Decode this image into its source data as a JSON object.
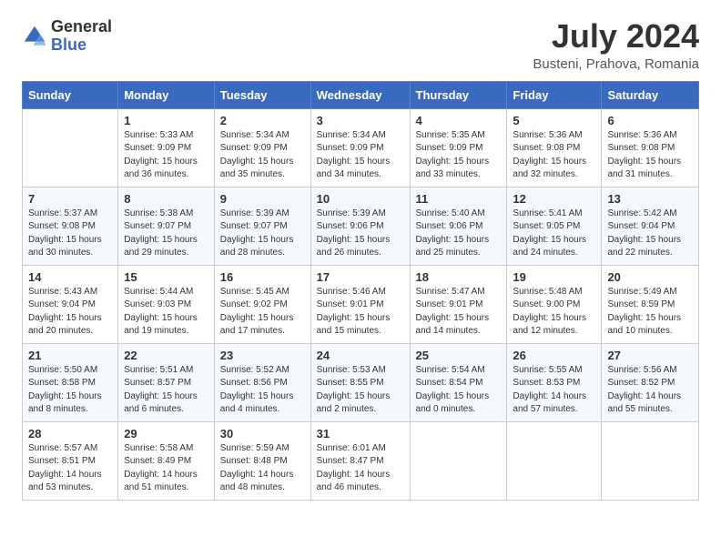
{
  "header": {
    "logo_general": "General",
    "logo_blue": "Blue",
    "month_year": "July 2024",
    "location": "Busteni, Prahova, Romania"
  },
  "weekdays": [
    "Sunday",
    "Monday",
    "Tuesday",
    "Wednesday",
    "Thursday",
    "Friday",
    "Saturday"
  ],
  "weeks": [
    [
      {
        "day": "",
        "info": ""
      },
      {
        "day": "1",
        "info": "Sunrise: 5:33 AM\nSunset: 9:09 PM\nDaylight: 15 hours\nand 36 minutes."
      },
      {
        "day": "2",
        "info": "Sunrise: 5:34 AM\nSunset: 9:09 PM\nDaylight: 15 hours\nand 35 minutes."
      },
      {
        "day": "3",
        "info": "Sunrise: 5:34 AM\nSunset: 9:09 PM\nDaylight: 15 hours\nand 34 minutes."
      },
      {
        "day": "4",
        "info": "Sunrise: 5:35 AM\nSunset: 9:09 PM\nDaylight: 15 hours\nand 33 minutes."
      },
      {
        "day": "5",
        "info": "Sunrise: 5:36 AM\nSunset: 9:08 PM\nDaylight: 15 hours\nand 32 minutes."
      },
      {
        "day": "6",
        "info": "Sunrise: 5:36 AM\nSunset: 9:08 PM\nDaylight: 15 hours\nand 31 minutes."
      }
    ],
    [
      {
        "day": "7",
        "info": "Sunrise: 5:37 AM\nSunset: 9:08 PM\nDaylight: 15 hours\nand 30 minutes."
      },
      {
        "day": "8",
        "info": "Sunrise: 5:38 AM\nSunset: 9:07 PM\nDaylight: 15 hours\nand 29 minutes."
      },
      {
        "day": "9",
        "info": "Sunrise: 5:39 AM\nSunset: 9:07 PM\nDaylight: 15 hours\nand 28 minutes."
      },
      {
        "day": "10",
        "info": "Sunrise: 5:39 AM\nSunset: 9:06 PM\nDaylight: 15 hours\nand 26 minutes."
      },
      {
        "day": "11",
        "info": "Sunrise: 5:40 AM\nSunset: 9:06 PM\nDaylight: 15 hours\nand 25 minutes."
      },
      {
        "day": "12",
        "info": "Sunrise: 5:41 AM\nSunset: 9:05 PM\nDaylight: 15 hours\nand 24 minutes."
      },
      {
        "day": "13",
        "info": "Sunrise: 5:42 AM\nSunset: 9:04 PM\nDaylight: 15 hours\nand 22 minutes."
      }
    ],
    [
      {
        "day": "14",
        "info": "Sunrise: 5:43 AM\nSunset: 9:04 PM\nDaylight: 15 hours\nand 20 minutes."
      },
      {
        "day": "15",
        "info": "Sunrise: 5:44 AM\nSunset: 9:03 PM\nDaylight: 15 hours\nand 19 minutes."
      },
      {
        "day": "16",
        "info": "Sunrise: 5:45 AM\nSunset: 9:02 PM\nDaylight: 15 hours\nand 17 minutes."
      },
      {
        "day": "17",
        "info": "Sunrise: 5:46 AM\nSunset: 9:01 PM\nDaylight: 15 hours\nand 15 minutes."
      },
      {
        "day": "18",
        "info": "Sunrise: 5:47 AM\nSunset: 9:01 PM\nDaylight: 15 hours\nand 14 minutes."
      },
      {
        "day": "19",
        "info": "Sunrise: 5:48 AM\nSunset: 9:00 PM\nDaylight: 15 hours\nand 12 minutes."
      },
      {
        "day": "20",
        "info": "Sunrise: 5:49 AM\nSunset: 8:59 PM\nDaylight: 15 hours\nand 10 minutes."
      }
    ],
    [
      {
        "day": "21",
        "info": "Sunrise: 5:50 AM\nSunset: 8:58 PM\nDaylight: 15 hours\nand 8 minutes."
      },
      {
        "day": "22",
        "info": "Sunrise: 5:51 AM\nSunset: 8:57 PM\nDaylight: 15 hours\nand 6 minutes."
      },
      {
        "day": "23",
        "info": "Sunrise: 5:52 AM\nSunset: 8:56 PM\nDaylight: 15 hours\nand 4 minutes."
      },
      {
        "day": "24",
        "info": "Sunrise: 5:53 AM\nSunset: 8:55 PM\nDaylight: 15 hours\nand 2 minutes."
      },
      {
        "day": "25",
        "info": "Sunrise: 5:54 AM\nSunset: 8:54 PM\nDaylight: 15 hours\nand 0 minutes."
      },
      {
        "day": "26",
        "info": "Sunrise: 5:55 AM\nSunset: 8:53 PM\nDaylight: 14 hours\nand 57 minutes."
      },
      {
        "day": "27",
        "info": "Sunrise: 5:56 AM\nSunset: 8:52 PM\nDaylight: 14 hours\nand 55 minutes."
      }
    ],
    [
      {
        "day": "28",
        "info": "Sunrise: 5:57 AM\nSunset: 8:51 PM\nDaylight: 14 hours\nand 53 minutes."
      },
      {
        "day": "29",
        "info": "Sunrise: 5:58 AM\nSunset: 8:49 PM\nDaylight: 14 hours\nand 51 minutes."
      },
      {
        "day": "30",
        "info": "Sunrise: 5:59 AM\nSunset: 8:48 PM\nDaylight: 14 hours\nand 48 minutes."
      },
      {
        "day": "31",
        "info": "Sunrise: 6:01 AM\nSunset: 8:47 PM\nDaylight: 14 hours\nand 46 minutes."
      },
      {
        "day": "",
        "info": ""
      },
      {
        "day": "",
        "info": ""
      },
      {
        "day": "",
        "info": ""
      }
    ]
  ]
}
